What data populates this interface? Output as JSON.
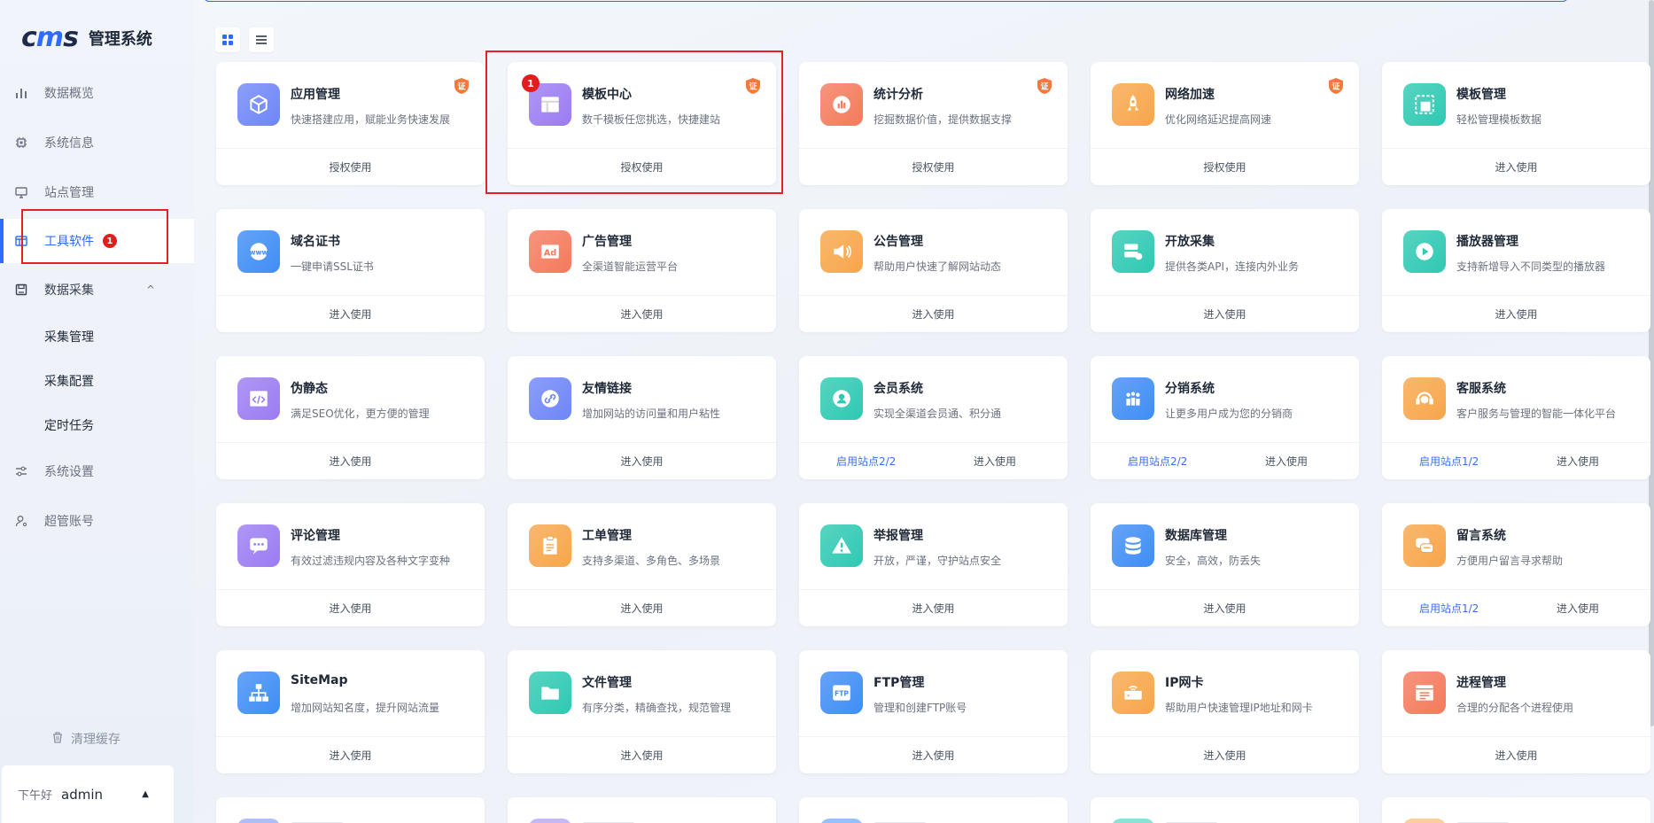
{
  "app": {
    "logo_text": "cms",
    "title": "管理系统"
  },
  "sidebar": {
    "items": [
      {
        "label": "数据概览",
        "icon": "bar-chart-icon"
      },
      {
        "label": "系统信息",
        "icon": "cpu-icon"
      },
      {
        "label": "站点管理",
        "icon": "monitor-icon"
      },
      {
        "label": "工具软件",
        "icon": "window-icon",
        "active": true,
        "badge": "1"
      },
      {
        "label": "数据采集",
        "icon": "save-icon",
        "expanded": true,
        "children": [
          "采集管理",
          "采集配置",
          "定时任务"
        ]
      },
      {
        "label": "系统设置",
        "icon": "sliders-icon"
      },
      {
        "label": "超管账号",
        "icon": "user-icon"
      }
    ],
    "clear_cache": "清理缓存",
    "greeting": "下午好",
    "username": "admin"
  },
  "cards": [
    {
      "name": "应用管理",
      "desc": "快速搭建应用，赋能业务快速发展",
      "action": "授权使用",
      "cert": true,
      "color": "#6e86f7",
      "glyph": "cube"
    },
    {
      "name": "模板中心",
      "desc": "数千模板任您挑选，快捷建站",
      "action": "授权使用",
      "cert": true,
      "color": "#9b7cf2",
      "glyph": "layout",
      "badge": "1"
    },
    {
      "name": "统计分析",
      "desc": "挖掘数据价值，提供数据支撑",
      "action": "授权使用",
      "cert": true,
      "color": "#f47a5c",
      "glyph": "chart"
    },
    {
      "name": "网络加速",
      "desc": "优化网络延迟提高网速",
      "action": "授权使用",
      "cert": true,
      "color": "#f7a64a",
      "glyph": "rocket"
    },
    {
      "name": "模板管理",
      "desc": "轻松管理模板数据",
      "action": "进入使用",
      "color": "#2ec9b2",
      "glyph": "template"
    },
    {
      "name": "域名证书",
      "desc": "一键申请SSL证书",
      "action": "进入使用",
      "color": "#3f8df5",
      "glyph": "www"
    },
    {
      "name": "广告管理",
      "desc": "全渠道智能运营平台",
      "action": "进入使用",
      "color": "#f47a5c",
      "glyph": "ad"
    },
    {
      "name": "公告管理",
      "desc": "帮助用户快速了解网站动态",
      "action": "进入使用",
      "color": "#f7a64a",
      "glyph": "speaker"
    },
    {
      "name": "开放采集",
      "desc": "提供各类API，连接内外业务",
      "action": "进入使用",
      "color": "#2ec9b2",
      "glyph": "server"
    },
    {
      "name": "播放器管理",
      "desc": "支持新增导入不同类型的播放器",
      "action": "进入使用",
      "color": "#2ec9b2",
      "glyph": "play"
    },
    {
      "name": "伪静态",
      "desc": "满足SEO优化，更方便的管理",
      "action": "进入使用",
      "color": "#9b7cf2",
      "glyph": "code"
    },
    {
      "name": "友情链接",
      "desc": "增加网站的访问量和用户粘性",
      "action": "进入使用",
      "color": "#6e86f7",
      "glyph": "link"
    },
    {
      "name": "会员系统",
      "desc": "实现全渠道会员通、积分通",
      "action": "进入使用",
      "link": "启用站点2/2",
      "color": "#2ec9b2",
      "glyph": "member"
    },
    {
      "name": "分销系统",
      "desc": "让更多用户成为您的分销商",
      "action": "进入使用",
      "link": "启用站点2/2",
      "color": "#3f8df5",
      "glyph": "people"
    },
    {
      "name": "客服系统",
      "desc": "客户服务与管理的智能一体化平台",
      "action": "进入使用",
      "link": "启用站点1/2",
      "color": "#f7a64a",
      "glyph": "headset"
    },
    {
      "name": "评论管理",
      "desc": "有效过滤违规内容及各种文字变种",
      "action": "进入使用",
      "color": "#9b7cf2",
      "glyph": "comment"
    },
    {
      "name": "工单管理",
      "desc": "支持多渠道、多角色、多场景",
      "action": "进入使用",
      "color": "#f7a64a",
      "glyph": "clipboard"
    },
    {
      "name": "举报管理",
      "desc": "开放，严谨，守护站点安全",
      "action": "进入使用",
      "color": "#2ec9b2",
      "glyph": "warning"
    },
    {
      "name": "数据库管理",
      "desc": "安全，高效，防丢失",
      "action": "进入使用",
      "color": "#3f8df5",
      "glyph": "database"
    },
    {
      "name": "留言系统",
      "desc": "方便用户留言寻求帮助",
      "action": "进入使用",
      "link": "启用站点1/2",
      "color": "#f7a64a",
      "glyph": "message"
    },
    {
      "name": "SiteMap",
      "desc": "增加网站知名度，提升网站流量",
      "action": "进入使用",
      "color": "#3f8df5",
      "glyph": "sitemap"
    },
    {
      "name": "文件管理",
      "desc": "有序分类，精确查找，规范管理",
      "action": "进入使用",
      "color": "#2ec9b2",
      "glyph": "folder"
    },
    {
      "name": "FTP管理",
      "desc": "管理和创建FTP账号",
      "action": "进入使用",
      "color": "#3f8df5",
      "glyph": "ftp"
    },
    {
      "name": "IP网卡",
      "desc": "帮助用户快速管理IP地址和网卡",
      "action": "进入使用",
      "color": "#f7a64a",
      "glyph": "router"
    },
    {
      "name": "进程管理",
      "desc": "合理的分配各个进程使用",
      "action": "进入使用",
      "color": "#f47a5c",
      "glyph": "process"
    }
  ],
  "partial_row_colors": [
    "#6e86f7",
    "#9b7cf2",
    "#3f8df5",
    "#2ec9b2",
    "#f7a64a"
  ]
}
